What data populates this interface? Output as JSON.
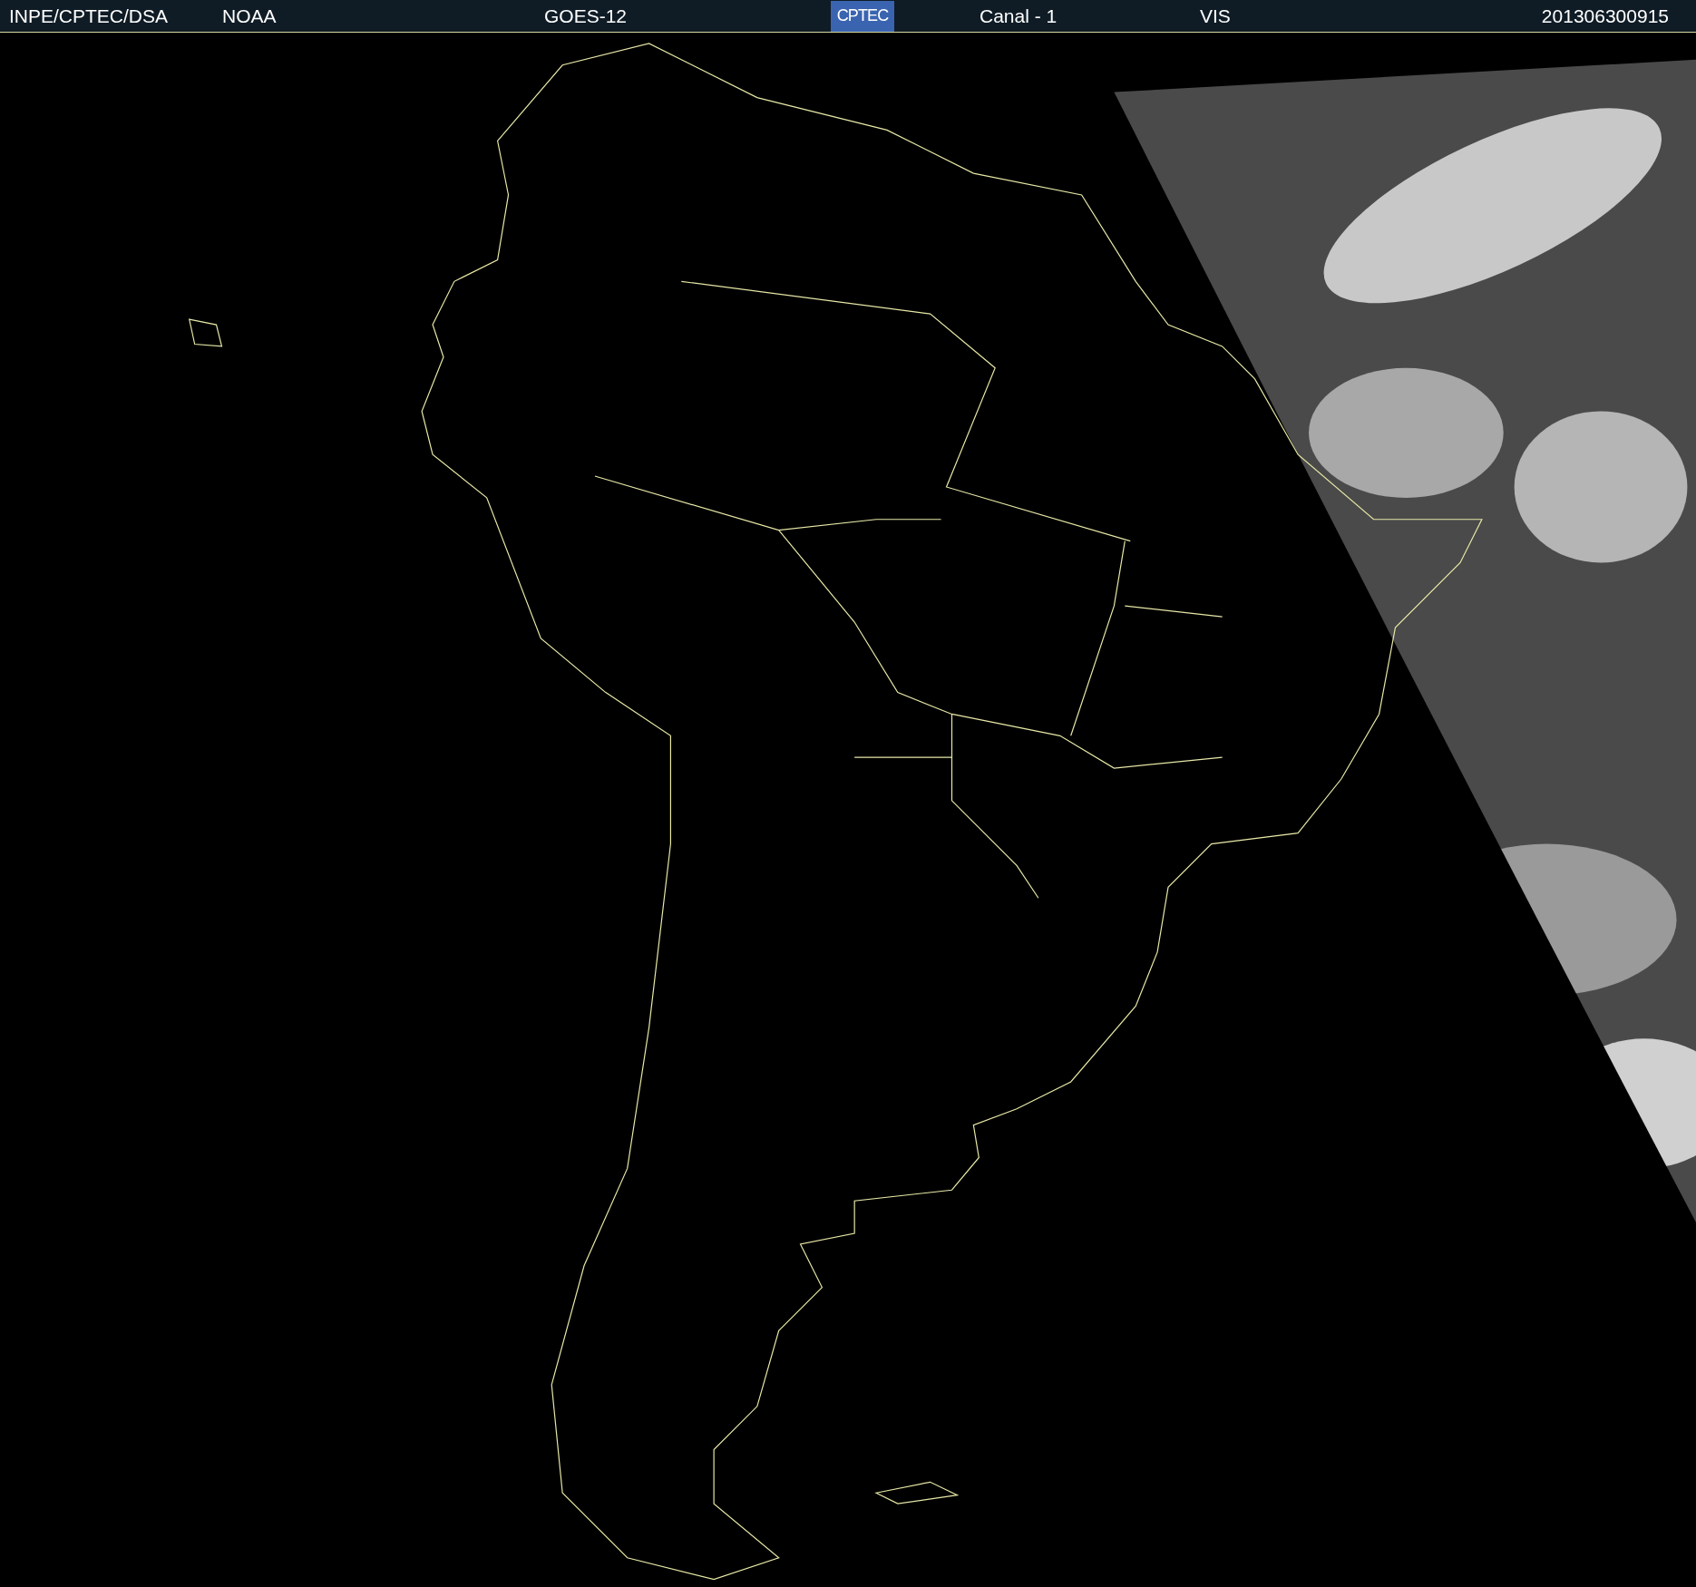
{
  "header": {
    "source": "INPE/CPTEC/DSA",
    "agency": "NOAA",
    "satellite": "GOES-12",
    "logo": "CPTEC",
    "channel": "Canal - 1",
    "band": "VIS",
    "timestamp": "201306300915"
  }
}
